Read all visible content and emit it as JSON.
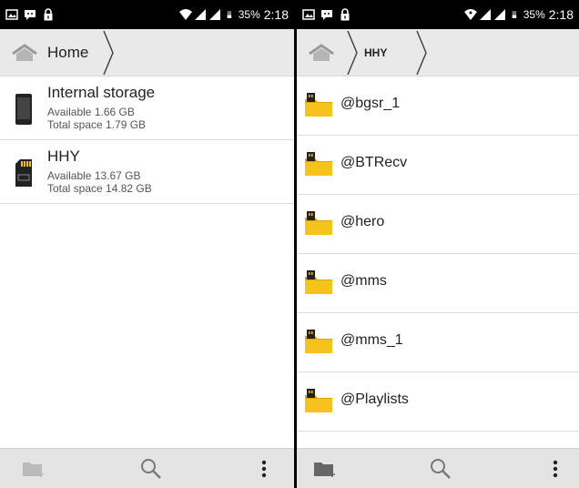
{
  "status_left": {
    "battery_pct": "35%",
    "time": "2:18"
  },
  "status_right": {
    "battery_pct": "35%",
    "time": "2:18"
  },
  "left_pane": {
    "breadcrumb": {
      "home_label": "Home"
    },
    "storages": [
      {
        "name": "Internal storage",
        "available": "Available 1.66 GB",
        "total": "Total space 1.79 GB",
        "icon": "phone-icon"
      },
      {
        "name": "HHY",
        "available": "Available 13.67 GB",
        "total": "Total space 14.82 GB",
        "icon": "sdcard-icon"
      }
    ]
  },
  "right_pane": {
    "breadcrumb": {
      "current": "HHY"
    },
    "folders": [
      {
        "name": "@bgsr_1"
      },
      {
        "name": "@BTRecv"
      },
      {
        "name": "@hero"
      },
      {
        "name": "@mms"
      },
      {
        "name": "@mms_1"
      },
      {
        "name": "@Playlists"
      }
    ]
  },
  "colors": {
    "folder": "#f6c21c",
    "folder_dark": "#e2a400",
    "toolbar": "#e4e4e4",
    "breadcrumb": "#e9e9e9"
  }
}
